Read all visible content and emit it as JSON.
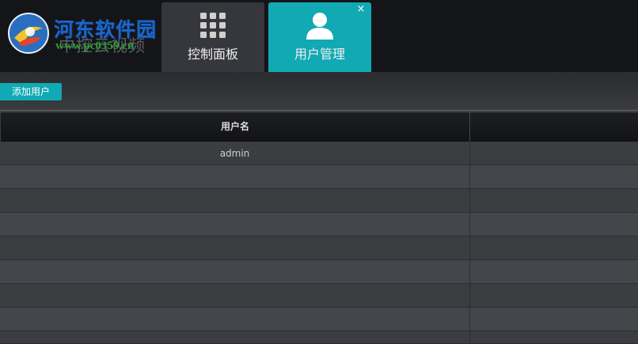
{
  "watermark": {
    "title": "河东软件园",
    "url": "www.pc0359.cn"
  },
  "app": {
    "product_name": "中控云视频"
  },
  "tabs": [
    {
      "label": "控制面板",
      "icon": "grid-icon",
      "active": false,
      "closable": false
    },
    {
      "label": "用户管理",
      "icon": "user-icon",
      "active": true,
      "closable": true,
      "close_glyph": "×"
    }
  ],
  "toolbar": {
    "add_user_label": "添加用户"
  },
  "table": {
    "columns": [
      "用户名",
      ""
    ],
    "rows": [
      [
        "admin",
        ""
      ],
      [
        "",
        ""
      ],
      [
        "",
        ""
      ],
      [
        "",
        ""
      ],
      [
        "",
        ""
      ],
      [
        "",
        ""
      ],
      [
        "",
        ""
      ],
      [
        "",
        ""
      ],
      [
        "",
        ""
      ]
    ]
  },
  "colors": {
    "accent": "#11a9b4",
    "topbar": "#141518",
    "tab_inactive": "#36373c",
    "row_odd": "#3c3d41",
    "row_even": "#45464b"
  }
}
